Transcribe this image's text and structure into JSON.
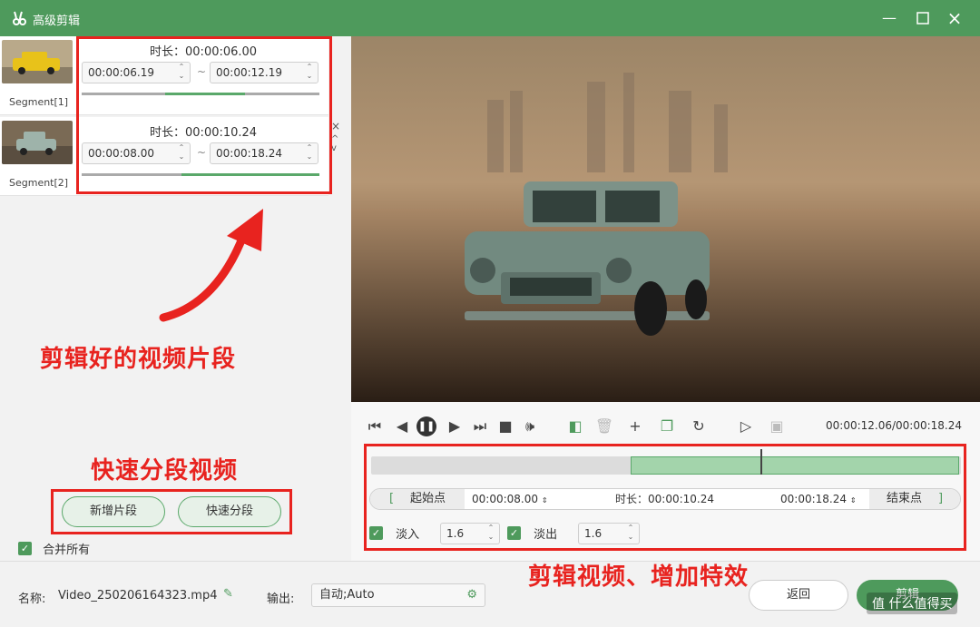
{
  "window": {
    "title": "高级剪辑",
    "minimize_icon": "minimize-icon",
    "maximize_icon": "maximize-icon",
    "close_icon": "close-icon"
  },
  "segments": [
    {
      "name": "Segment[1]",
      "duration_label": "时长：",
      "duration": "00:00:06.00",
      "start": "00:00:06.19",
      "end": "00:00:12.19",
      "separator": "~",
      "progress": 0.35
    },
    {
      "name": "Segment[2]",
      "duration_label": "时长：",
      "duration": "00:00:10.24",
      "start": "00:00:08.00",
      "end": "00:00:18.24",
      "separator": "~",
      "progress": 0.75
    }
  ],
  "segment_controls": {
    "close": "×",
    "up": "^",
    "down": "v"
  },
  "annotations": {
    "clips_label": "剪辑好的视频片段",
    "split_label": "快速分段视频",
    "effects_label": "剪辑视频、增加特效"
  },
  "left_buttons": {
    "new_segment": "新增片段",
    "quick_split": "快速分段"
  },
  "merge_all": {
    "label": "合并所有",
    "checked": true
  },
  "playback": {
    "timecode": "00:00:12.06/00:00:18.24",
    "playhead_fraction": 0.66,
    "selection_start_fraction": 0.44,
    "selection_end_fraction": 1.0
  },
  "trim": {
    "start_button": "起始点",
    "start_time": "00:00:08.00",
    "duration_label": "时长：",
    "duration": "00:00:10.24",
    "end_time": "00:00:18.24",
    "end_button": "结束点"
  },
  "fade": {
    "fade_in_label": "淡入",
    "fade_in_value": "1.6",
    "fade_out_label": "淡出",
    "fade_out_value": "1.6"
  },
  "footer": {
    "name_label": "名称:",
    "file_name": "Video_250206164323.mp4",
    "output_label": "输出:",
    "output_value": "自动;Auto",
    "back_button": "返回",
    "cut_button": "剪辑",
    "watermark": "值 什么值得买"
  },
  "colors": {
    "accent": "#4e9a5c",
    "annotation": "#e8231f"
  }
}
